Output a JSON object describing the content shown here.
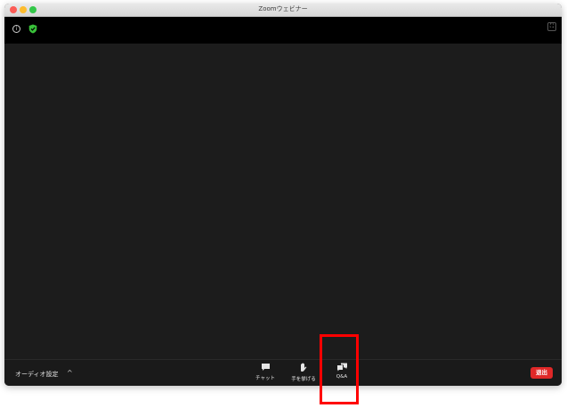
{
  "window": {
    "title": "Zoomウェビナー"
  },
  "topbar": {
    "info_icon": "info-icon",
    "security_icon": "shield-check-icon",
    "security_color": "#39c13a",
    "fullscreen_icon": "fullscreen-icon"
  },
  "toolbar": {
    "audio_settings_label": "オーディオ設定",
    "audio_caret": "^",
    "buttons": [
      {
        "label": "チャット",
        "icon": "chat-icon"
      },
      {
        "label": "手を挙げる",
        "icon": "raise-hand-icon"
      },
      {
        "label": "Q&A",
        "icon": "qa-icon"
      }
    ],
    "leave_label": "退出",
    "leave_color": "#e02828"
  },
  "annotation": {
    "highlight_color": "#ff0000",
    "highlight_target": "Q&A"
  }
}
